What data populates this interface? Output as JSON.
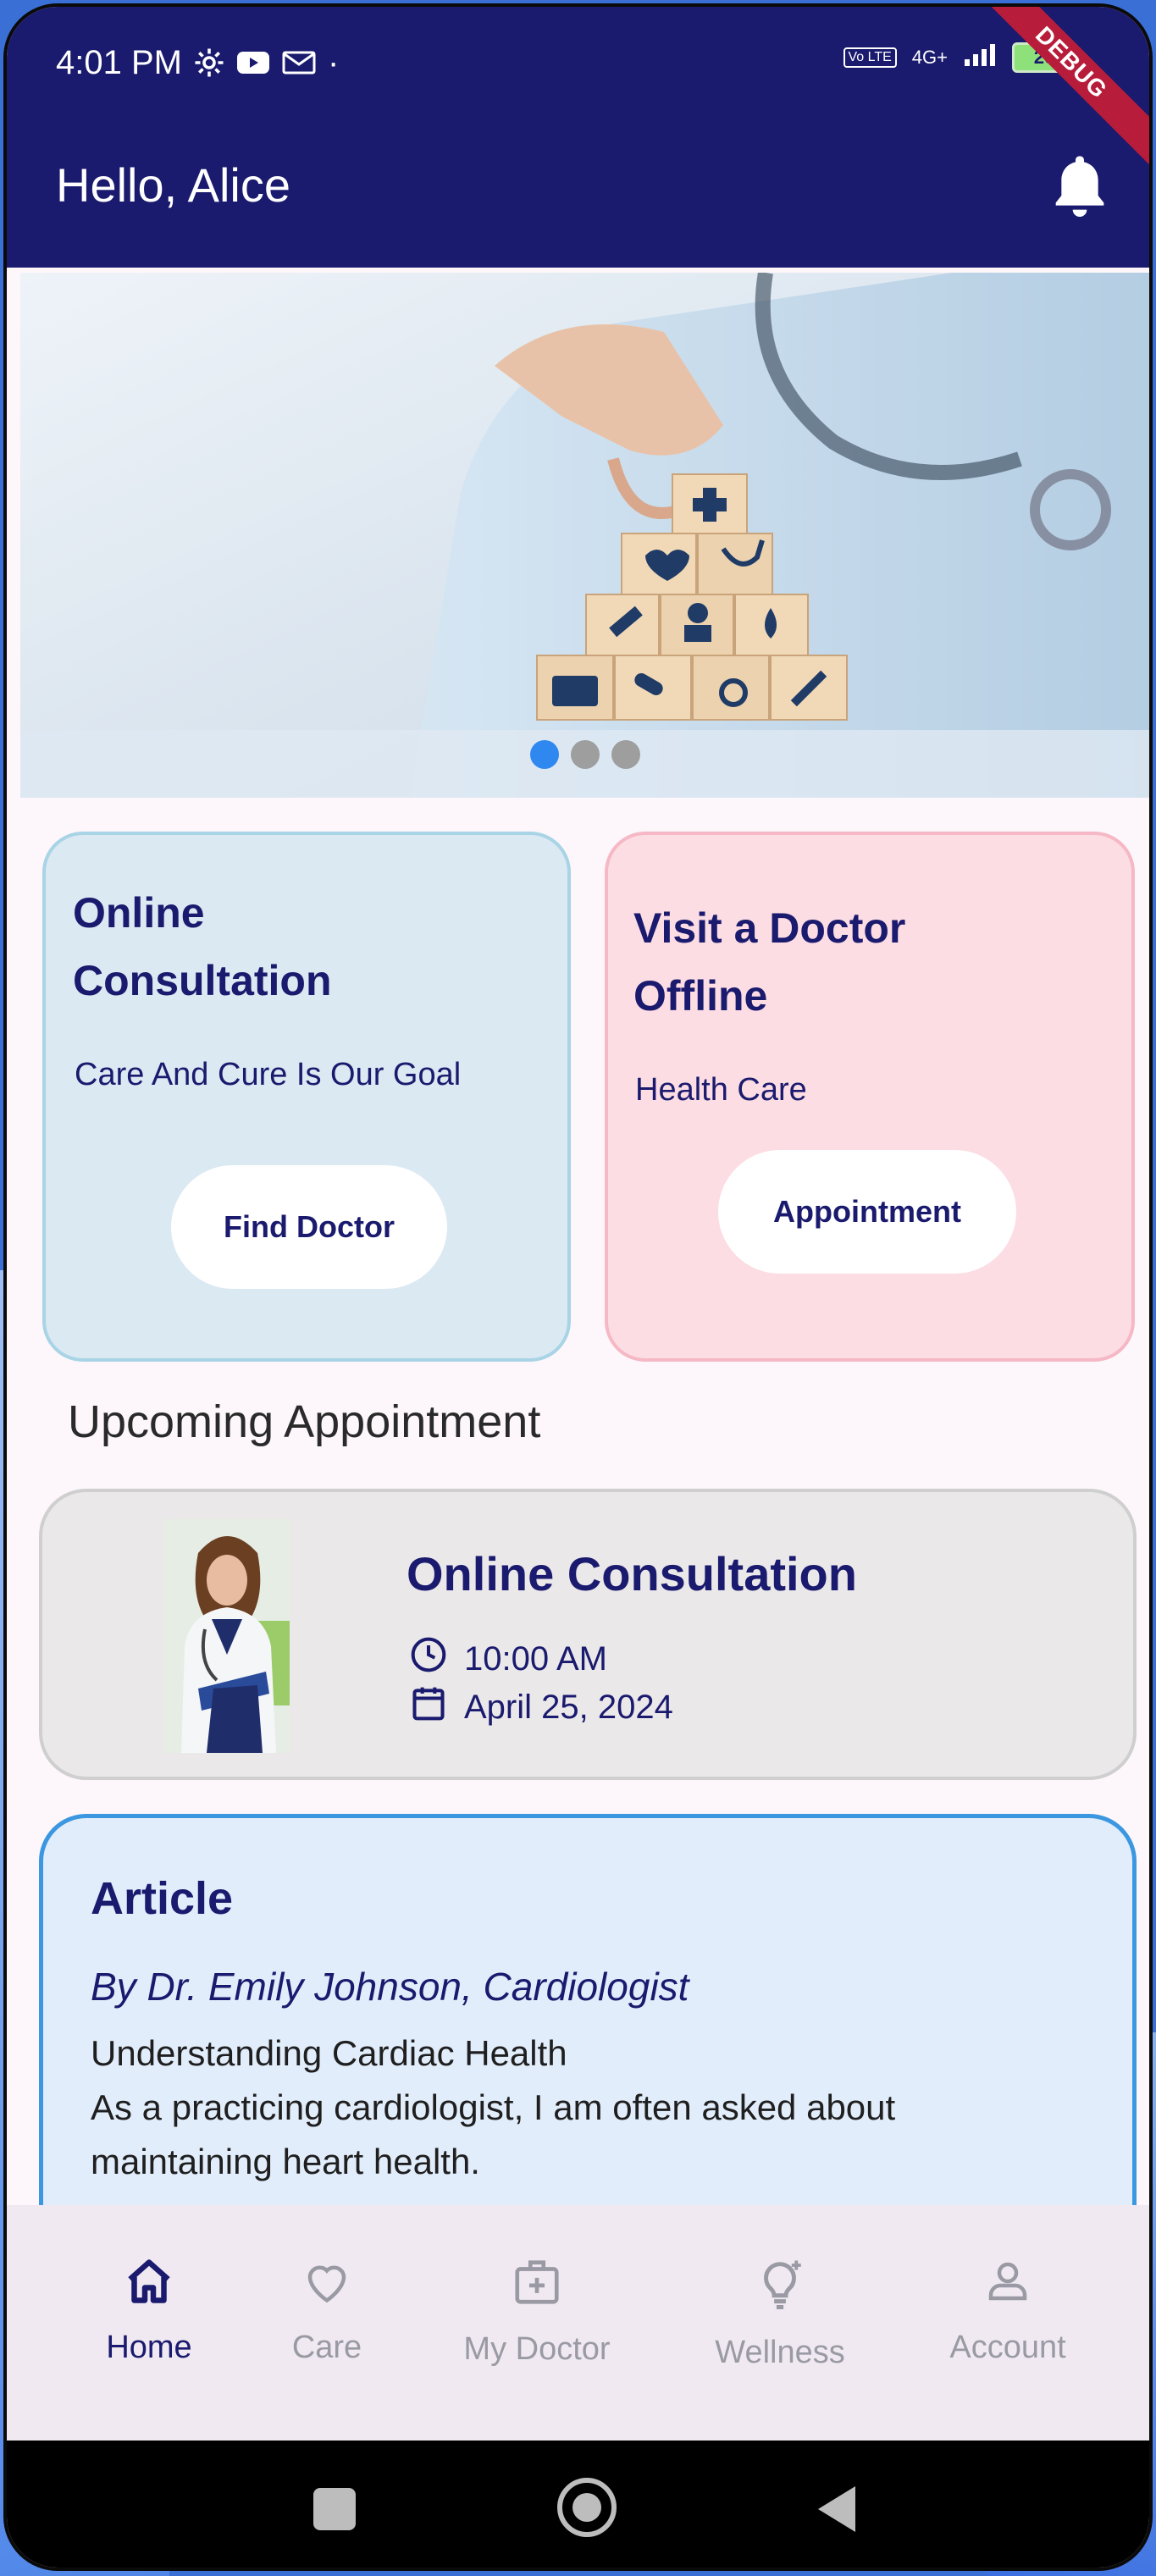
{
  "status_bar": {
    "time": "4:01 PM",
    "volte": "Vo LTE",
    "network": "4G+",
    "battery": "26",
    "debug_banner": "DEBUG"
  },
  "app_bar": {
    "greeting": "Hello, Alice",
    "notification_icon": "bell-icon"
  },
  "carousel": {
    "page_count": 3,
    "active_index": 0
  },
  "services": {
    "online": {
      "title_line1": "Online",
      "title_line2": "Consultation",
      "subtitle": "Care And Cure Is Our Goal",
      "button": "Find Doctor"
    },
    "offline": {
      "title_line1": "Visit a Doctor",
      "title_line2": "Offline",
      "subtitle": "Health Care",
      "button": "Appointment"
    }
  },
  "upcoming": {
    "heading": "Upcoming Appointment",
    "title": "Online Consultation",
    "time": "10:00 AM",
    "date": "April 25, 2024"
  },
  "article": {
    "heading": "Article",
    "author": "By Dr. Emily Johnson, Cardiologist",
    "title": "Understanding Cardiac Health",
    "excerpt_line1": "As a practicing cardiologist, I am often asked about",
    "excerpt_line2": "maintaining heart health."
  },
  "bottom_nav": {
    "items": [
      {
        "label": "Home",
        "icon": "home-icon",
        "active": true
      },
      {
        "label": "Care",
        "icon": "heart-icon",
        "active": false
      },
      {
        "label": "My Doctor",
        "icon": "medical-kit-icon",
        "active": false
      },
      {
        "label": "Wellness",
        "icon": "lightbulb-icon",
        "active": false
      },
      {
        "label": "Account",
        "icon": "person-icon",
        "active": false
      }
    ]
  },
  "colors": {
    "primary": "#1a1a6e",
    "online_card": "#dbe9f2",
    "offline_card": "#fcdde3",
    "article_card": "#e2edfb",
    "accent_blue": "#2f88f0"
  }
}
